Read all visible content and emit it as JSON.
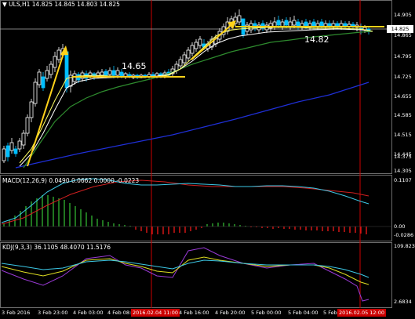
{
  "header": {
    "symbol_line": "▼ ULS,H1  14.825 14.845 14.803 14.825",
    "macd_line": "MACD(12,26,9) 0.0490 0.0662 0.0000 -0.0223",
    "kdj_line": "KDJ(9,3,3) 36.1105 48.4070 11.5176"
  },
  "price_axis": [
    "14.905",
    "14.865",
    "14.795",
    "14.725",
    "14.655",
    "14.585",
    "14.515",
    "14.445",
    "14.375",
    "14.305"
  ],
  "current_price": "14.825",
  "macd_axis": [
    "0.1107",
    "0.00",
    "-0.0286"
  ],
  "kdj_axis": [
    "109.8231",
    "2.6834"
  ],
  "annotations": {
    "level_1": "14.65",
    "level_2": "14.82"
  },
  "time_axis": [
    "3 Feb 2016",
    "3 Feb 23:00",
    "4 Feb 03:00",
    "4 Feb 08:00",
    "4 Feb 16:00",
    "4 Feb 20:00",
    "5 Feb 00:00",
    "5 Feb 04:00",
    "5 Feb"
  ],
  "highlighted_times": [
    "2016.02.04 11:00",
    "2016.02.05 12:00"
  ],
  "colors": {
    "background": "#000000",
    "bull_candle": "#ffffff",
    "bear_candle": "#00bfff",
    "ma_fast": "#ffff66",
    "ma_mid": "#ffffff",
    "ma_slow": "#2e8b2e",
    "ma_long": "#1f2fd6",
    "marker_line": "#cc0000",
    "trend_arrow": "#ffd21a"
  }
}
